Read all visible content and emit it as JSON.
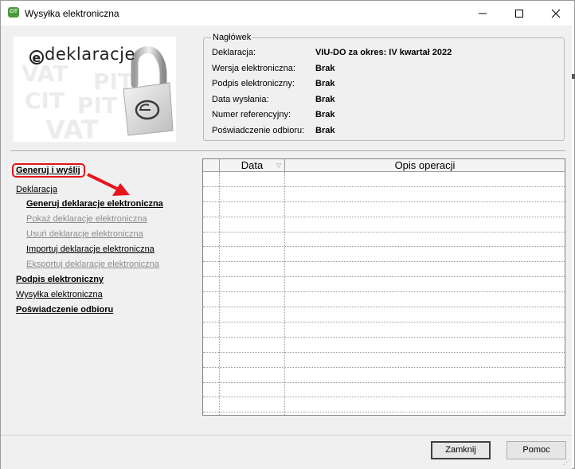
{
  "window": {
    "title": "Wysyłka elektroniczna",
    "app_icon_text": "CiT"
  },
  "logo": {
    "title_tail": "deklaracje",
    "e_letter": "e",
    "bg_words": [
      "VAT",
      "PIT",
      "CIT",
      "PIT",
      "VAT"
    ]
  },
  "header_group": {
    "legend": "Nagłówek",
    "rows": [
      {
        "label": "Deklaracja:",
        "value": "VIU-DO za okres: IV kwartał 2022"
      },
      {
        "label": "Wersja elektroniczna:",
        "value": "Brak"
      },
      {
        "label": "Podpis elektroniczny:",
        "value": "Brak"
      },
      {
        "label": "Data wysłania:",
        "value": "Brak"
      },
      {
        "label": "Numer referencyjny:",
        "value": "Brak"
      },
      {
        "label": "Poświadczenie odbioru:",
        "value": "Brak"
      }
    ]
  },
  "nav": {
    "generate_send": "Generuj i wyślij",
    "declaration": "Deklaracja",
    "generate_decl": "Generuj deklaracje elektroniczna",
    "show_decl": "Pokaż deklaracje elektroniczna",
    "delete_decl": "Usuń deklaracje elektroniczna",
    "import_decl": "Importuj deklaracje elektroniczna",
    "export_decl": "Eksportuj deklaracje elektroniczna",
    "signature": "Podpis elektroniczny",
    "shipment": "Wysyłka elektroniczna",
    "receipt": "Poświadczenie odbioru"
  },
  "grid": {
    "columns": [
      "Data",
      "Opis operacji"
    ],
    "rows": []
  },
  "buttons": {
    "close": "Zamknij",
    "help": "Pomoc"
  },
  "colors": {
    "highlight": "#e0141a",
    "arrow": "#e8141b",
    "accent_icon": "#4c9a3c"
  }
}
